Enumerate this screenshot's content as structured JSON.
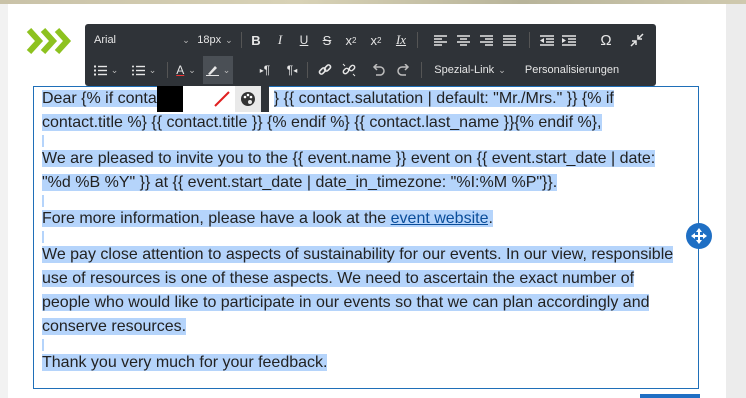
{
  "toolbar": {
    "font_family": "Arial",
    "font_size": "18px",
    "bold": "B",
    "italic": "I",
    "underline": "U",
    "strikethrough": "S",
    "superscript_base": "x",
    "superscript_mark": "2",
    "subscript_base": "x",
    "subscript_mark": "2",
    "clear_format": "Ix",
    "special_link": "Spezial-Link",
    "personalize": "Personalisierungen",
    "omega": "Ω",
    "font_color_letter": "A",
    "ltr_mark": "¶",
    "rtl_mark": "¶"
  },
  "editor": {
    "p1_line1_a": "Dear {% if conta",
    "p1_line1_b": "} {{ contact.salutation | default: \"Mr./Mrs.\" }} {% if",
    "p1_line2": "contact.title %} {{ contact.title }} {% endif %} {{ contact.last_name }}{% endif %},",
    "p2_line1": "We are pleased to invite you to the {{ event.name }} event on {{ event.start_date | date:",
    "p2_line2": "\"%d %B %Y\" }} at {{ event.start_date | date_in_timezone: \"%I:%M %P\"}}.",
    "p3_before": "Fore more information, please have a look at the ",
    "p3_link": "event website",
    "p3_after": ".",
    "p4_line1": "We pay close attention to aspects of sustainability for our events. In our view, responsible",
    "p4_line2": "use of resources is one of these aspects. We need to ascertain the exact number of",
    "p4_line3": "people who would like to participate in our events so that we can plan accordingly and",
    "p4_line4": "conserve resources.",
    "p5": "Thank you very much for your feedback."
  },
  "colors": {
    "accent_green": "#8dc21f",
    "toolbar_bg": "#2f3338",
    "selection": "#b5d4fb",
    "editor_border": "#1f6fb8",
    "link": "#0a4d9a"
  },
  "icons": [
    "chevrons-right-icon",
    "bold-icon",
    "italic-icon",
    "underline-icon",
    "strikethrough-icon",
    "superscript-icon",
    "subscript-icon",
    "clear-format-icon",
    "align-left-icon",
    "align-center-icon",
    "align-right-icon",
    "align-justify-icon",
    "outdent-icon",
    "indent-icon",
    "omega-icon",
    "collapse-icon",
    "ordered-list-icon",
    "unordered-list-icon",
    "font-color-icon",
    "highlight-icon",
    "ltr-icon",
    "rtl-icon",
    "link-icon",
    "unlink-icon",
    "undo-icon",
    "redo-icon",
    "palette-icon",
    "move-icon"
  ]
}
